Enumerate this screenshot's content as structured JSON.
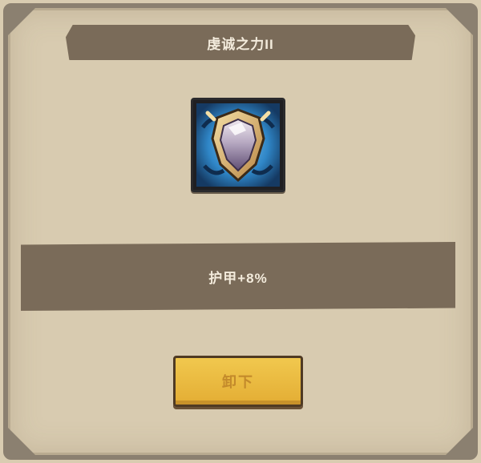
{
  "dialog": {
    "title": "虔诚之力II",
    "icon": "shield-icon",
    "effect_text": "护甲+8%",
    "unequip_label": "卸下"
  },
  "colors": {
    "parchment": "#d8cbb0",
    "banner": "#7a6b59",
    "button": "#e9b73d",
    "icon_glow": "#2f86c7"
  }
}
